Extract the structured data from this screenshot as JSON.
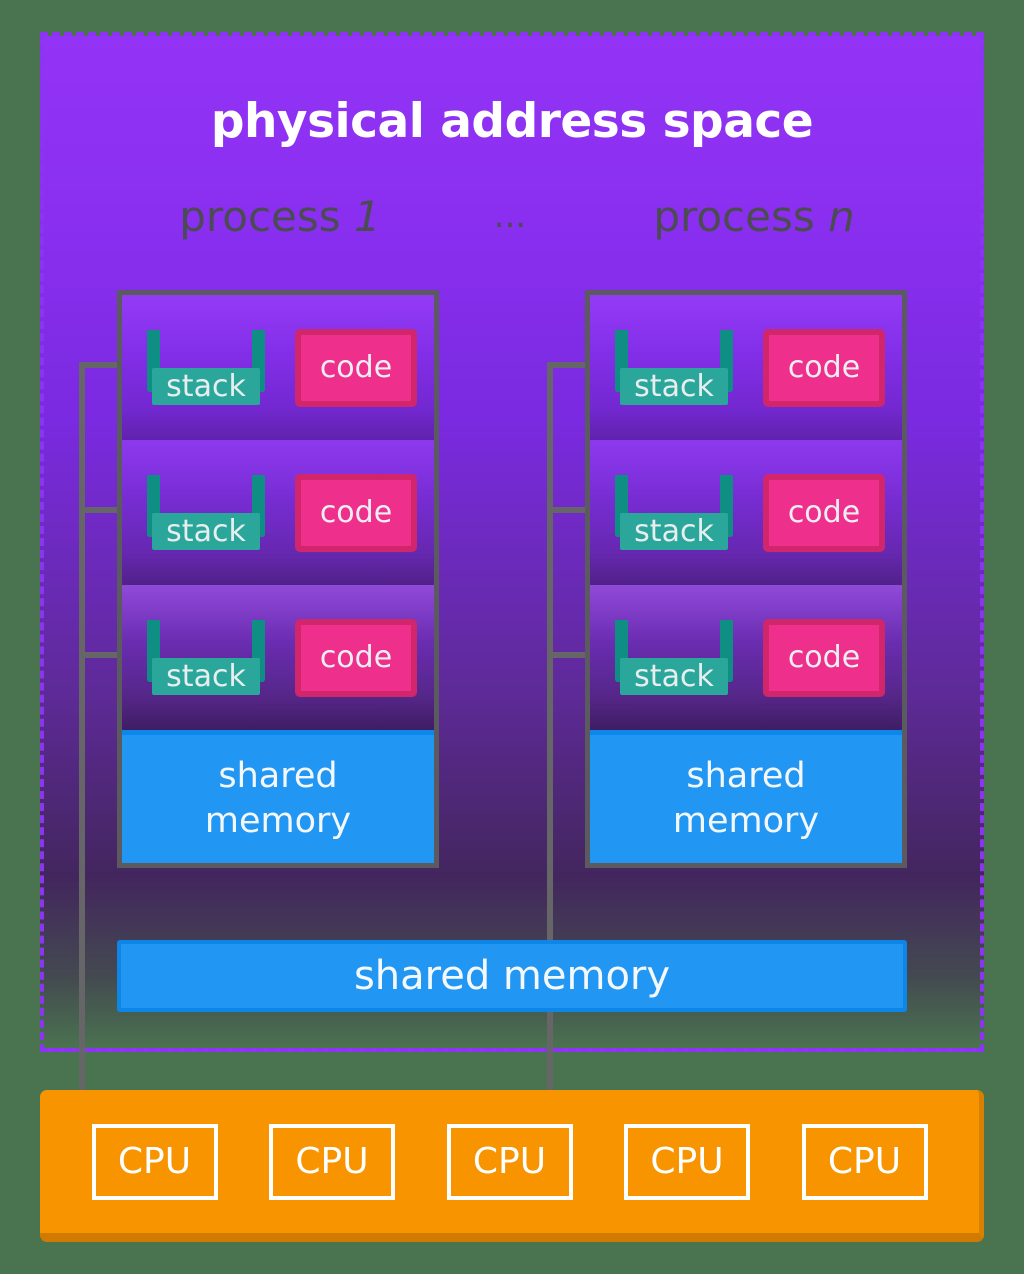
{
  "colors": {
    "page_background": "#4a7350",
    "panel_fill_top": "#9333f5",
    "panel_fill_bottom": "#43265e",
    "panel_dashed_border": "#8b35f0",
    "process_border": "#5a5a5f",
    "connector_line": "#666669",
    "stack_bracket": "#0f8f84",
    "stack_fill": "#2aa79a",
    "code_border": "#d1256c",
    "code_fill": "#ef2f8c",
    "shared_memory": "#2196f3",
    "shared_memory_edge": "#0e86e8",
    "cpu_bar": "#f79400",
    "cpu_bar_shadow": "#d07b00",
    "label_gray": "#4b4b52",
    "text_white": "#ffffff"
  },
  "panel": {
    "title": "physical address space"
  },
  "process_labels": {
    "first_prefix": "process ",
    "first_index": "1",
    "ellipsis": "...",
    "last_prefix": "process ",
    "last_index": "n"
  },
  "processes": [
    {
      "id": "process-1",
      "threads": [
        {
          "stack_label": "stack",
          "code_label": "code"
        },
        {
          "stack_label": "stack",
          "code_label": "code"
        },
        {
          "stack_label": "stack",
          "code_label": "code"
        }
      ],
      "shared_memory_line1": "shared",
      "shared_memory_line2": "memory"
    },
    {
      "id": "process-n",
      "threads": [
        {
          "stack_label": "stack",
          "code_label": "code"
        },
        {
          "stack_label": "stack",
          "code_label": "code"
        },
        {
          "stack_label": "stack",
          "code_label": "code"
        }
      ],
      "shared_memory_line1": "shared",
      "shared_memory_line2": "memory"
    }
  ],
  "global_shared_memory": {
    "label": "shared memory"
  },
  "cpu_bank": {
    "cpus": [
      {
        "label": "CPU"
      },
      {
        "label": "CPU"
      },
      {
        "label": "CPU"
      },
      {
        "label": "CPU"
      },
      {
        "label": "CPU"
      }
    ]
  }
}
